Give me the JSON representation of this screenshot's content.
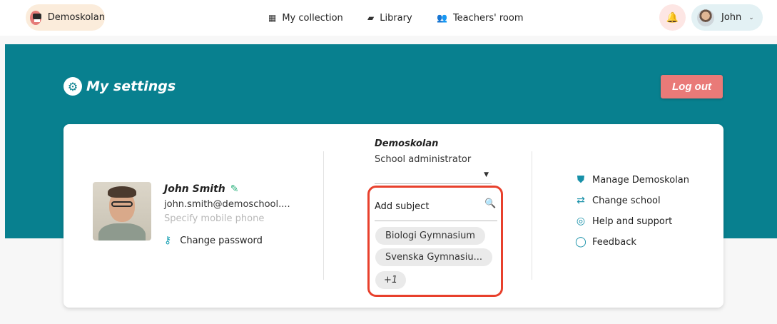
{
  "nav": {
    "school_name": "Demoskolan",
    "items": [
      {
        "label": "My collection",
        "icon": "grid-icon"
      },
      {
        "label": "Library",
        "icon": "book-icon"
      },
      {
        "label": "Teachers' room",
        "icon": "people-icon"
      }
    ],
    "user_name": "John"
  },
  "header": {
    "title": "My settings",
    "logout_label": "Log out"
  },
  "profile": {
    "full_name": "John Smith",
    "email": "john.smith@demoschool....",
    "phone_placeholder": "Specify mobile phone",
    "change_password_label": "Change password"
  },
  "school": {
    "name": "Demoskolan",
    "role": "School administrator",
    "subject_placeholder": "Add subject",
    "subjects": [
      "Biologi Gymnasium",
      "Svenska Gymnasiu..."
    ],
    "more_label": "+1"
  },
  "actions": [
    {
      "label": "Manage Demoskolan",
      "icon": "shield-icon"
    },
    {
      "label": "Change school",
      "icon": "swap-arrows-icon"
    },
    {
      "label": "Help and support",
      "icon": "lifebuoy-icon"
    },
    {
      "label": "Feedback",
      "icon": "speech-bubble-icon"
    }
  ],
  "colors": {
    "teal": "#08808f",
    "logout": "#e97a78",
    "highlight": "#e8402c"
  }
}
